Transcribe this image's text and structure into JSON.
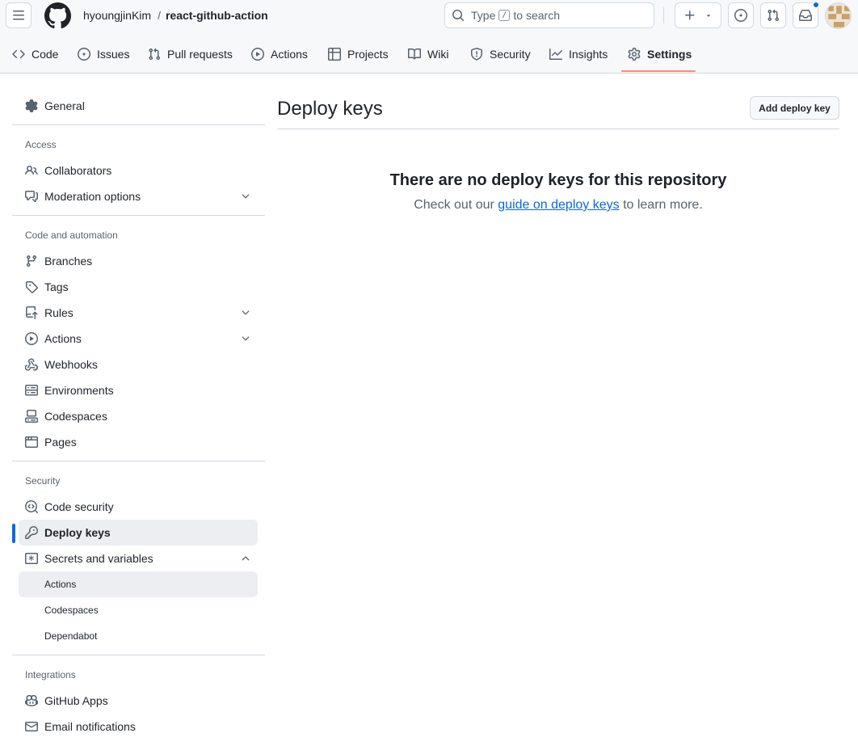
{
  "header": {
    "owner": "hyoungjinKim",
    "separator": "/",
    "repo": "react-github-action",
    "search_prefix": "Type",
    "search_key": "/",
    "search_suffix": "to search"
  },
  "tabs": [
    {
      "label": "Code",
      "icon": "code-icon"
    },
    {
      "label": "Issues",
      "icon": "issue-icon"
    },
    {
      "label": "Pull requests",
      "icon": "pull-request-icon"
    },
    {
      "label": "Actions",
      "icon": "play-icon"
    },
    {
      "label": "Projects",
      "icon": "table-icon"
    },
    {
      "label": "Wiki",
      "icon": "book-icon"
    },
    {
      "label": "Security",
      "icon": "shield-icon"
    },
    {
      "label": "Insights",
      "icon": "graph-icon"
    },
    {
      "label": "Settings",
      "icon": "gear-icon",
      "selected": true
    }
  ],
  "sidebar": {
    "general": "General",
    "groups": {
      "access": "Access",
      "code_automation": "Code and automation",
      "security": "Security",
      "integrations": "Integrations"
    },
    "items": {
      "collaborators": "Collaborators",
      "moderation": "Moderation options",
      "branches": "Branches",
      "tags": "Tags",
      "rules": "Rules",
      "actions": "Actions",
      "webhooks": "Webhooks",
      "environments": "Environments",
      "codespaces": "Codespaces",
      "pages": "Pages",
      "code_security": "Code security",
      "deploy_keys": "Deploy keys",
      "secrets": "Secrets and variables",
      "secrets_actions": "Actions",
      "secrets_codespaces": "Codespaces",
      "secrets_dependabot": "Dependabot",
      "github_apps": "GitHub Apps",
      "email_notifications": "Email notifications"
    }
  },
  "main": {
    "title": "Deploy keys",
    "add_button": "Add deploy key",
    "blank_title": "There are no deploy keys for this repository",
    "blank_prefix": "Check out our",
    "blank_link": "guide on deploy keys",
    "blank_suffix": "to learn more."
  },
  "colors": {
    "accent": "#0969da",
    "tab_underline": "#fd8c73",
    "notification_dot": "#0969da"
  }
}
